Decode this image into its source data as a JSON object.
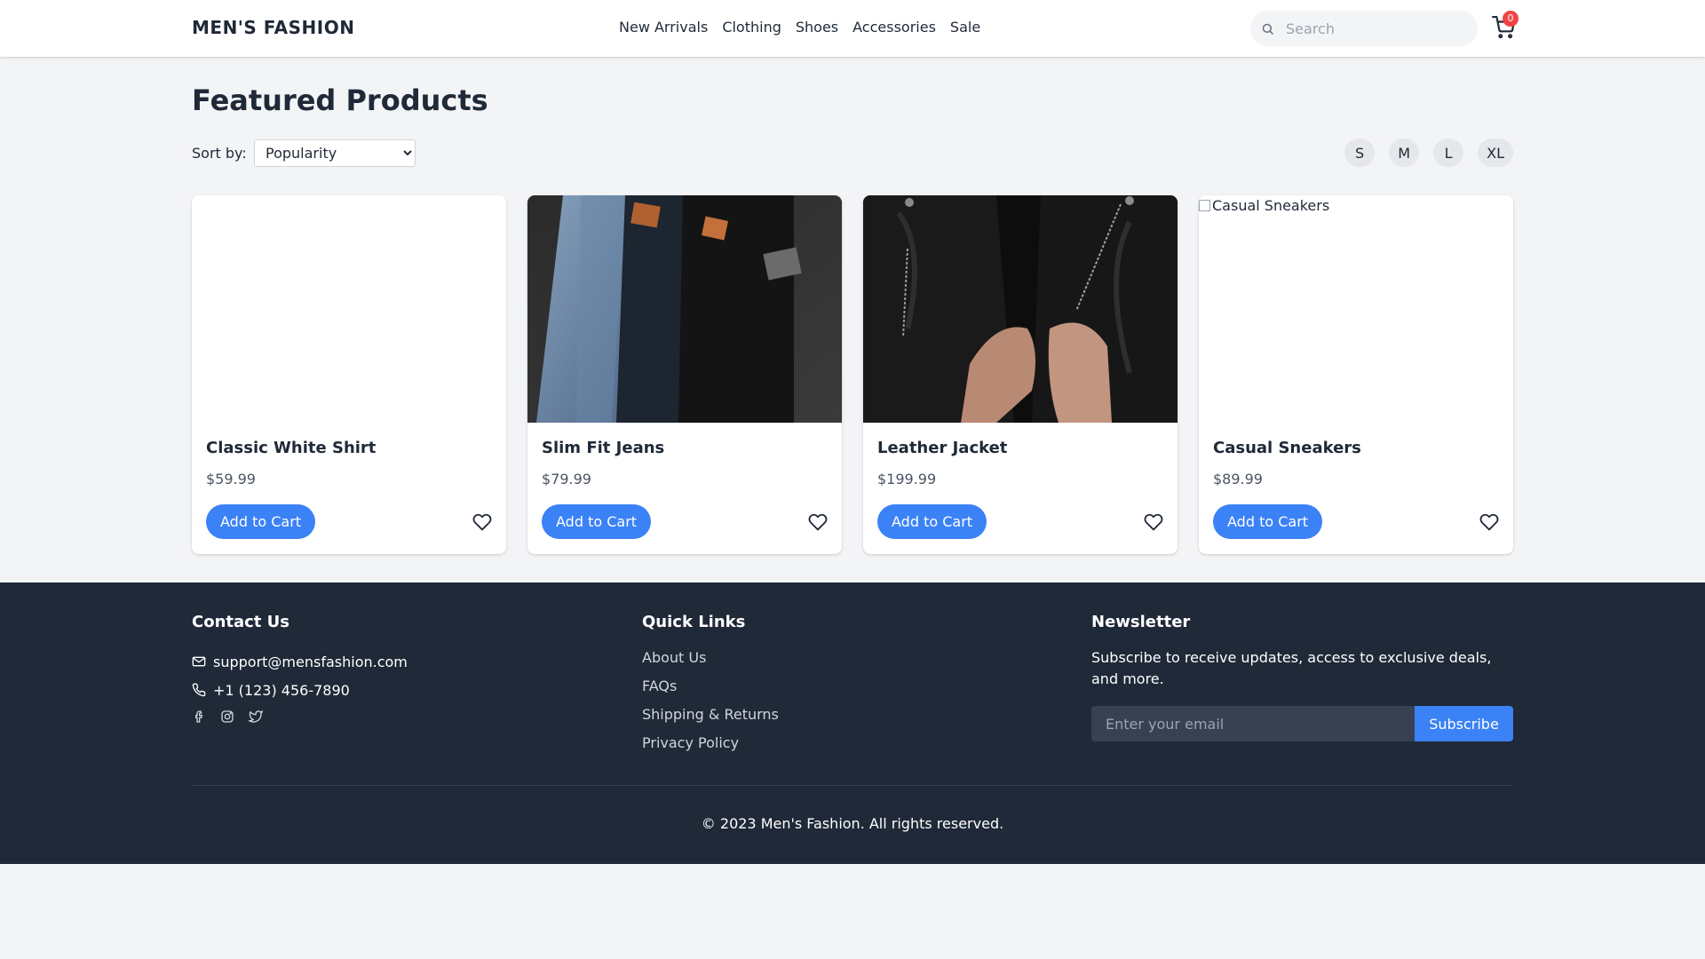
{
  "header": {
    "brand": "MEN'S FASHION",
    "nav": [
      "New Arrivals",
      "Clothing",
      "Shoes",
      "Accessories",
      "Sale"
    ],
    "search_placeholder": "Search",
    "cart_count": "0"
  },
  "main": {
    "title": "Featured Products",
    "sort_label": "Sort by:",
    "sort_selected": "Popularity",
    "sizes": [
      "S",
      "M",
      "L",
      "XL"
    ],
    "add_to_cart_label": "Add to Cart",
    "products": [
      {
        "name": "Classic White Shirt",
        "price": "$59.99",
        "image": "blank"
      },
      {
        "name": "Slim Fit Jeans",
        "price": "$79.99",
        "image": "jeans"
      },
      {
        "name": "Leather Jacket",
        "price": "$199.99",
        "image": "jacket"
      },
      {
        "name": "Casual Sneakers",
        "price": "$89.99",
        "image": "broken",
        "alt": "Casual Sneakers"
      }
    ]
  },
  "footer": {
    "contact_heading": "Contact Us",
    "email": "support@mensfashion.com",
    "phone": "+1 (123) 456-7890",
    "social_icons": [
      "facebook-icon",
      "instagram-icon",
      "twitter-icon"
    ],
    "quick_links_heading": "Quick Links",
    "quick_links": [
      "About Us",
      "FAQs",
      "Shipping & Returns",
      "Privacy Policy"
    ],
    "newsletter_heading": "Newsletter",
    "newsletter_text": "Subscribe to receive updates, access to exclusive deals, and more.",
    "newsletter_placeholder": "Enter your email",
    "subscribe_label": "Subscribe",
    "copyright": "© 2023 Men's Fashion. All rights reserved."
  },
  "colors": {
    "accent": "#3b82f6",
    "badge": "#ef4444",
    "footer_bg": "#1f2937",
    "page_bg": "#f3f4f6"
  }
}
